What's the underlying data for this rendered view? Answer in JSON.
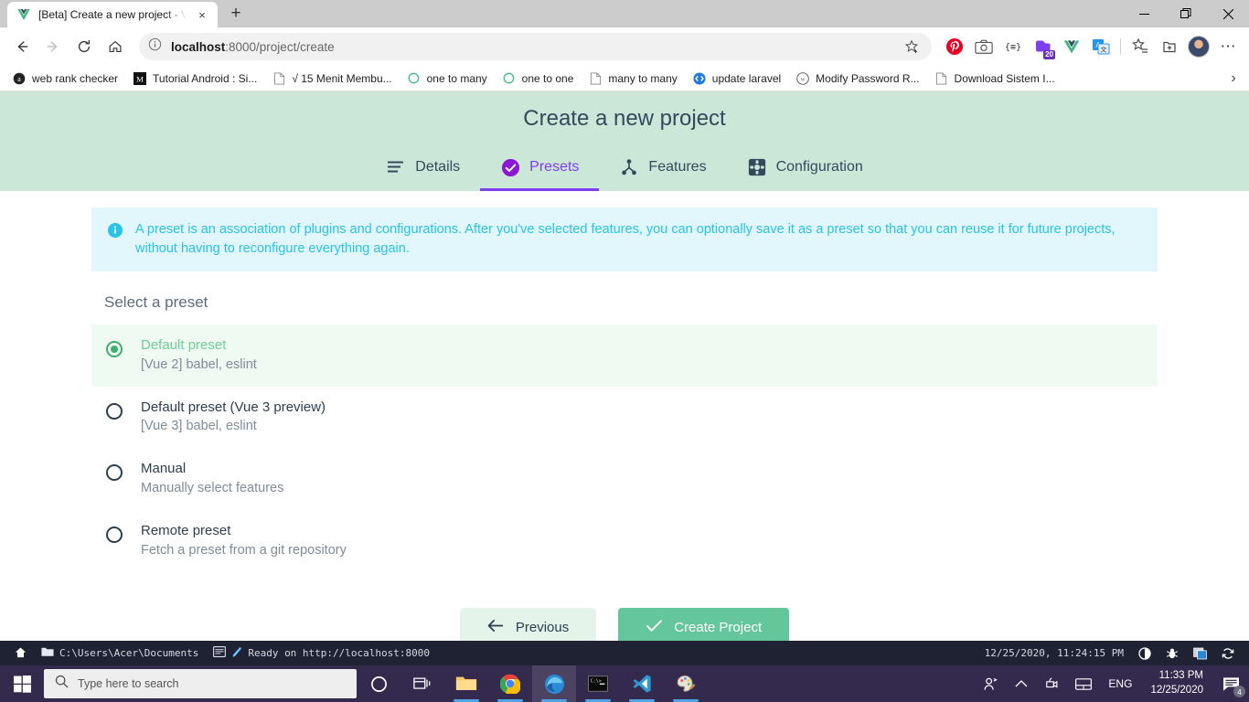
{
  "browser": {
    "tab": {
      "title": "[Beta] Create a new project - Vue",
      "favicon": "vue-logo-icon",
      "close": "×"
    },
    "new_tab_label": "+",
    "window_controls": {
      "minimize": "minimize-icon",
      "maximize": "maximize-icon",
      "close": "close-icon"
    },
    "nav": {
      "back": "back-arrow-icon",
      "forward": "forward-arrow-icon",
      "reload": "reload-icon",
      "home": "home-icon"
    },
    "omnibox": {
      "info_icon": "info-circle-icon",
      "url_bold": "localhost",
      "url_rest": ":8000/project/create",
      "star": "favorite-star-icon"
    },
    "toolbar_icons": [
      {
        "name": "pinterest-extension-icon"
      },
      {
        "name": "screenshot-extension-icon"
      },
      {
        "name": "code-snippet-extension-icon"
      },
      {
        "name": "pocket-extension-icon",
        "badge": "20"
      },
      {
        "name": "vue-devtools-extension-icon"
      },
      {
        "name": "translate-extension-icon"
      },
      {
        "name": "collections-star-icon"
      },
      {
        "name": "add-tab-group-icon"
      },
      {
        "name": "profile-avatar"
      },
      {
        "name": "settings-more-icon",
        "glyph": "⋯"
      }
    ],
    "bookmarks": [
      {
        "label": "web rank checker",
        "icon": "alexa-icon"
      },
      {
        "label": "Tutorial Android : Si...",
        "icon": "medium-icon"
      },
      {
        "label": "√ 15 Menit Membu...",
        "icon": "page-icon"
      },
      {
        "label": "one to many",
        "icon": "circle-icon"
      },
      {
        "label": "one to one",
        "icon": "circle-icon"
      },
      {
        "label": "many to many",
        "icon": "page-icon"
      },
      {
        "label": "update laravel",
        "icon": "code-icon"
      },
      {
        "label": "Modify Password R...",
        "icon": "wordpress-icon"
      },
      {
        "label": "Download Sistem I...",
        "icon": "page-icon"
      }
    ],
    "bookmarks_overflow": "›"
  },
  "app": {
    "title": "Create a new project",
    "tabs": [
      {
        "label": "Details",
        "icon": "list-lines-icon",
        "active": false
      },
      {
        "label": "Presets",
        "icon": "check-circle-icon",
        "active": true
      },
      {
        "label": "Features",
        "icon": "features-node-icon",
        "active": false
      },
      {
        "label": "Configuration",
        "icon": "gear-square-icon",
        "active": false
      }
    ],
    "info_banner": {
      "icon": "info-circle-icon",
      "text": "A preset is an association of plugins and configurations. After you've selected features, you can optionally save it as a preset so that you can reuse it for future projects, without having to reconfigure everything again."
    },
    "section_label": "Select a preset",
    "presets": [
      {
        "name": "Default preset",
        "description": "[Vue 2] babel, eslint",
        "selected": true
      },
      {
        "name": "Default preset (Vue 3 preview)",
        "description": "[Vue 3] babel, eslint",
        "selected": false
      },
      {
        "name": "Manual",
        "description": "Manually select features",
        "selected": false
      },
      {
        "name": "Remote preset",
        "description": "Fetch a preset from a git repository",
        "selected": false
      }
    ],
    "buttons": {
      "previous": {
        "label": "Previous",
        "icon": "arrow-left-icon"
      },
      "create": {
        "label": "Create Project",
        "icon": "check-icon"
      }
    },
    "colors": {
      "header_bg": "#cbe7d8",
      "accent_purple": "#7e3ff2",
      "accent_green": "#64c79b",
      "info_blue": "#28c3e8",
      "selected_row_bg": "#effaf3"
    }
  },
  "status_bar": {
    "home_icon": "home-icon",
    "folder_icon": "folder-icon",
    "path": "C:\\Users\\Acer\\Documents",
    "terminal_icon": "terminal-icon",
    "pencil_icon": "pencil-icon",
    "ready_text": "Ready on http://localhost:8000",
    "timestamp": "12/25/2020, 11:24:15 PM",
    "right_icons": [
      "contrast-icon",
      "bug-icon",
      "theme-icon",
      "refresh-icon"
    ]
  },
  "taskbar": {
    "start": "windows-start-icon",
    "search": {
      "icon": "search-icon",
      "placeholder": "Type here to search"
    },
    "apps": [
      {
        "name": "cortana-icon",
        "running": false,
        "active": false
      },
      {
        "name": "task-view-icon",
        "running": false,
        "active": false
      },
      {
        "name": "file-explorer-icon",
        "running": true,
        "active": false
      },
      {
        "name": "chrome-icon",
        "running": true,
        "active": false
      },
      {
        "name": "edge-icon",
        "running": true,
        "active": true
      },
      {
        "name": "command-prompt-icon",
        "running": true,
        "active": false
      },
      {
        "name": "vscode-icon",
        "running": true,
        "active": false
      },
      {
        "name": "paint-icon",
        "running": true,
        "active": false
      }
    ],
    "tray": {
      "people_icon": "people-icon",
      "chevron_up_icon": "chevron-up-icon",
      "camera_icon": "camera-icon",
      "touchpad_icon": "touchpad-icon",
      "language": "ENG",
      "time": "11:33 PM",
      "date": "12/25/2020",
      "notifications": "4"
    }
  }
}
